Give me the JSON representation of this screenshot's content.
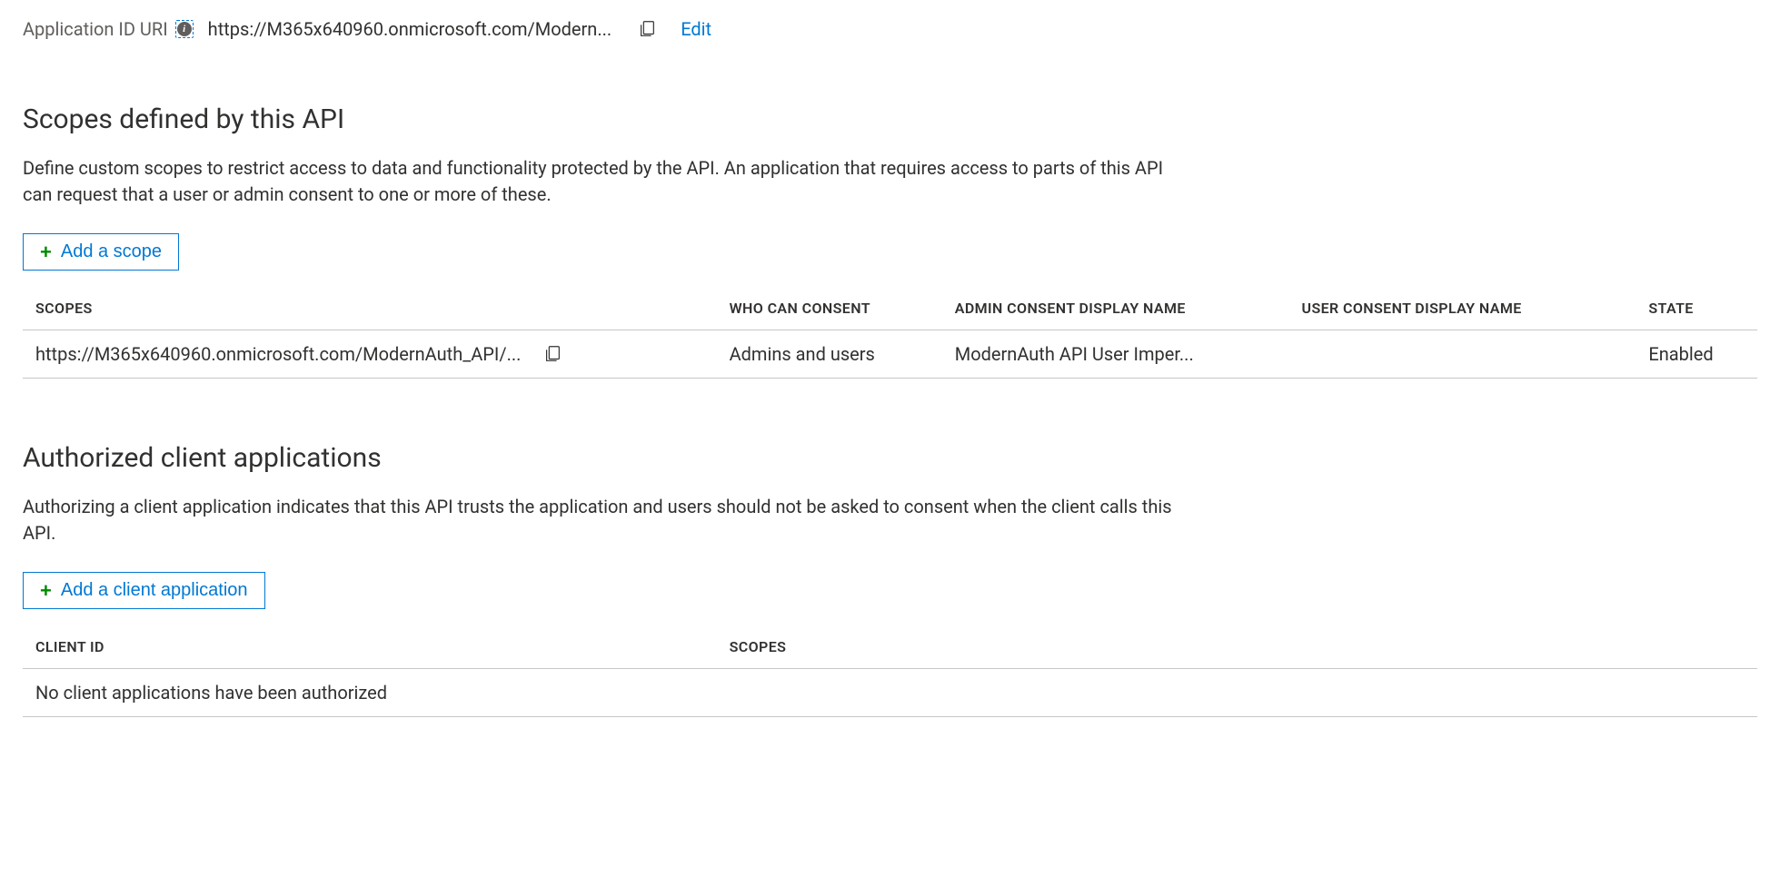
{
  "header": {
    "app_id_label": "Application ID URI",
    "app_id_value": "https://M365x640960.onmicrosoft.com/Modern...",
    "edit_label": "Edit"
  },
  "scopes_section": {
    "heading": "Scopes defined by this API",
    "description": "Define custom scopes to restrict access to data and functionality protected by the API. An application that requires access to parts of this API can request that a user or admin consent to one or more of these.",
    "add_button": "Add a scope",
    "columns": {
      "scopes": "SCOPES",
      "who_can_consent": "WHO CAN CONSENT",
      "admin_consent": "ADMIN CONSENT DISPLAY NAME",
      "user_consent": "USER CONSENT DISPLAY NAME",
      "state": "STATE"
    },
    "rows": [
      {
        "scope": "https://M365x640960.onmicrosoft.com/ModernAuth_API/...",
        "who_can_consent": "Admins and users",
        "admin_consent": "ModernAuth API User Imper...",
        "user_consent": "",
        "state": "Enabled"
      }
    ]
  },
  "clients_section": {
    "heading": "Authorized client applications",
    "description": "Authorizing a client application indicates that this API trusts the application and users should not be asked to consent when the client calls this API.",
    "add_button": "Add a client application",
    "columns": {
      "client_id": "CLIENT ID",
      "scopes": "SCOPES"
    },
    "empty_message": "No client applications have been authorized"
  }
}
